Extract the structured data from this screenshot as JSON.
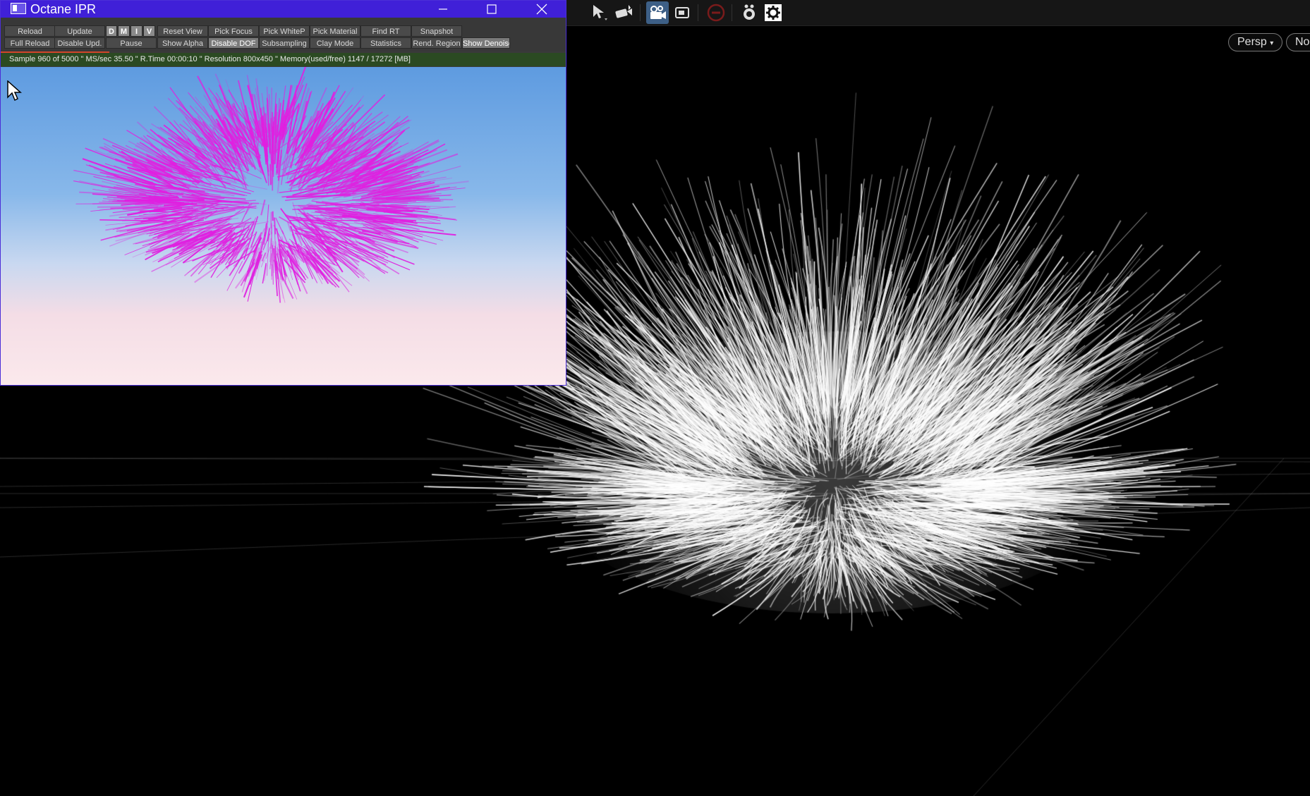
{
  "ipr": {
    "title": "Octane IPR",
    "window_controls": {
      "minimize": "─",
      "maximize": "☐",
      "close": "✕"
    },
    "toolbar_row1": {
      "reload": "Reload",
      "update": "Update",
      "d": "D",
      "m": "M",
      "i": "I",
      "v": "V",
      "reset_view": "Reset View",
      "pick_focus": "Pick Focus",
      "pick_whitep": "Pick WhiteP",
      "pick_material": "Pick Material",
      "find_rt": "Find RT",
      "snapshot": "Snapshot"
    },
    "toolbar_row2": {
      "full_reload": "Full Reload",
      "disable_upd": "Disable Upd.",
      "pause": "Pause",
      "show_alpha": "Show Alpha",
      "disable_dof": "Disable DOF",
      "subsampling": "Subsampling",
      "clay_mode": "Clay Mode",
      "statistics": "Statistics",
      "rend_region": "Rend. Region",
      "show_denoise": "Show Denoise"
    },
    "status_text": "Sample 960 of 5000 \" MS/sec 35.50 \" R.Time 00:00:10 \" Resolution 800x450 \" Memory(used/free) 1147 / 17272 [MB]",
    "progress_fraction": 0.192,
    "render_hair_color": "#e020e0"
  },
  "viewport": {
    "camera_menu": "Persp",
    "display_menu": "No",
    "hair_color": "#ffffff",
    "background": "#000000",
    "toolbar_icons": [
      "select-pose-icon",
      "camera-link-icon",
      "render-region-icon",
      "snapshot-view-icon",
      "disabled-icon",
      "camera-settings-icon",
      "gear-icon"
    ]
  }
}
